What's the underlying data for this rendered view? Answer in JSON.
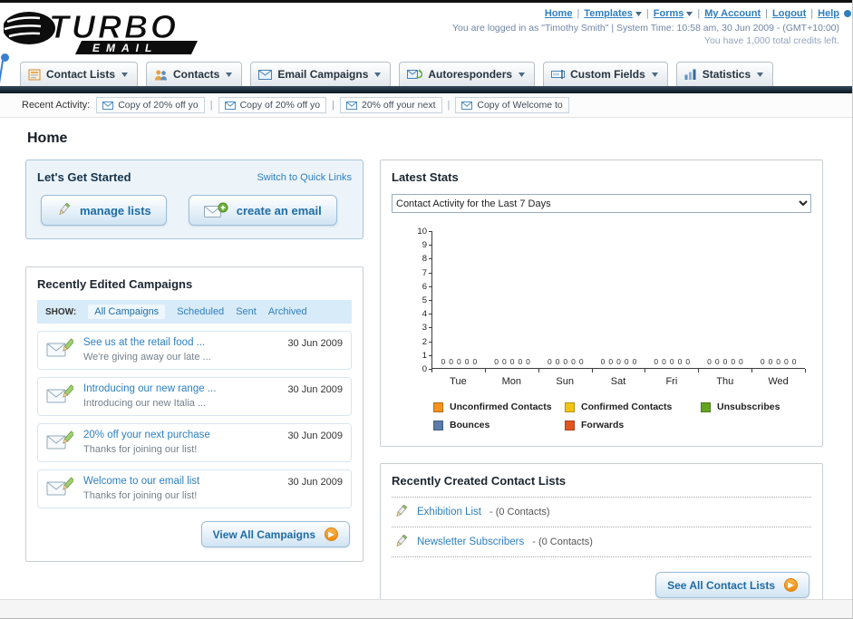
{
  "colors": {
    "link": "#2d7fc1",
    "navbar_dark": "#0b161f",
    "accent_orange": "#f0921e"
  },
  "header": {
    "logo_title": "TURBO",
    "logo_subtitle": "EMAIL",
    "sep": "|",
    "nav_links": [
      {
        "label": "Home"
      },
      {
        "label": "Templates",
        "arrow": true
      },
      {
        "label": "Forms",
        "arrow": true
      },
      {
        "label": "My Account"
      },
      {
        "label": "Logout"
      },
      {
        "label": "Help"
      }
    ],
    "login_info": "You are logged in as \"Timothy Smith\" | System Time: 10:58 am, 30 Jun 2009 - (GMT+10:00)",
    "credits_info": "You have 1,000 total credits left."
  },
  "nav_tabs": [
    {
      "label": "Contact Lists",
      "icon": "contact-lists-icon"
    },
    {
      "label": "Contacts",
      "icon": "contacts-icon"
    },
    {
      "label": "Email Campaigns",
      "icon": "email-campaigns-icon"
    },
    {
      "label": "Autoresponders",
      "icon": "autoresponders-icon"
    },
    {
      "label": "Custom Fields",
      "icon": "custom-fields-icon"
    },
    {
      "label": "Statistics",
      "icon": "statistics-icon"
    }
  ],
  "recent_activity": {
    "label": "Recent Activity:",
    "sep": "|",
    "items": [
      "Copy of 20% off yo",
      "Copy of 20% off yo",
      "20% off your next",
      "Copy of Welcome to"
    ]
  },
  "page_title": "Home",
  "get_started": {
    "title": "Let's Get Started",
    "switch_link": "Switch to Quick Links",
    "manage_lists_label": "manage lists",
    "create_email_label": "create an email"
  },
  "campaigns": {
    "title": "Recently Edited Campaigns",
    "show_label": "SHOW:",
    "filters": [
      {
        "label": "All Campaigns",
        "selected": true
      },
      {
        "label": "Scheduled"
      },
      {
        "label": "Sent"
      },
      {
        "label": "Archived"
      }
    ],
    "items": [
      {
        "title": "See us at the retail food ...",
        "subtitle": "We're giving away our late ...",
        "date": "30 Jun 2009"
      },
      {
        "title": "Introducing our new range ...",
        "subtitle": "Introducing our new Italia ...",
        "date": "30 Jun 2009"
      },
      {
        "title": "20% off your next purchase",
        "subtitle": "Thanks for joining our list!",
        "date": "30 Jun 2009"
      },
      {
        "title": "Welcome to our email list",
        "subtitle": "Thanks for joining our list!",
        "date": "30 Jun 2009"
      }
    ],
    "view_all_label": "View All Campaigns"
  },
  "latest_stats": {
    "title": "Latest Stats",
    "dropdown_value": "Contact Activity for the Last 7 Days",
    "chart_data": {
      "type": "bar",
      "title": "Contact Activity for the Last 7 Days",
      "categories": [
        "Tue",
        "Mon",
        "Sun",
        "Sat",
        "Fri",
        "Thu",
        "Wed"
      ],
      "series": [
        {
          "name": "Unconfirmed Contacts",
          "color": "#f6921e",
          "values": [
            0,
            0,
            0,
            0,
            0,
            0,
            0
          ]
        },
        {
          "name": "Confirmed Contacts",
          "color": "#f2c411",
          "values": [
            0,
            0,
            0,
            0,
            0,
            0,
            0
          ]
        },
        {
          "name": "Unsubscribes",
          "color": "#64a422",
          "values": [
            0,
            0,
            0,
            0,
            0,
            0,
            0
          ]
        },
        {
          "name": "Bounces",
          "color": "#5a7ca8",
          "values": [
            0,
            0,
            0,
            0,
            0,
            0,
            0
          ]
        },
        {
          "name": "Forwards",
          "color": "#e2551f",
          "values": [
            0,
            0,
            0,
            0,
            0,
            0,
            0
          ]
        }
      ],
      "ylim": [
        0,
        10
      ],
      "yticks": [
        0,
        1,
        2,
        3,
        4,
        5,
        6,
        7,
        8,
        9,
        10
      ],
      "xlabel": "",
      "ylabel": "",
      "grid": false,
      "legend_position": "bottom"
    }
  },
  "contact_lists": {
    "title": "Recently Created Contact Lists",
    "items": [
      {
        "name": "Exhibition List",
        "detail": "- (0 Contacts)"
      },
      {
        "name": "Newsletter Subscribers",
        "detail": "- (0 Contacts)"
      }
    ],
    "see_all_label": "See All Contact Lists"
  }
}
